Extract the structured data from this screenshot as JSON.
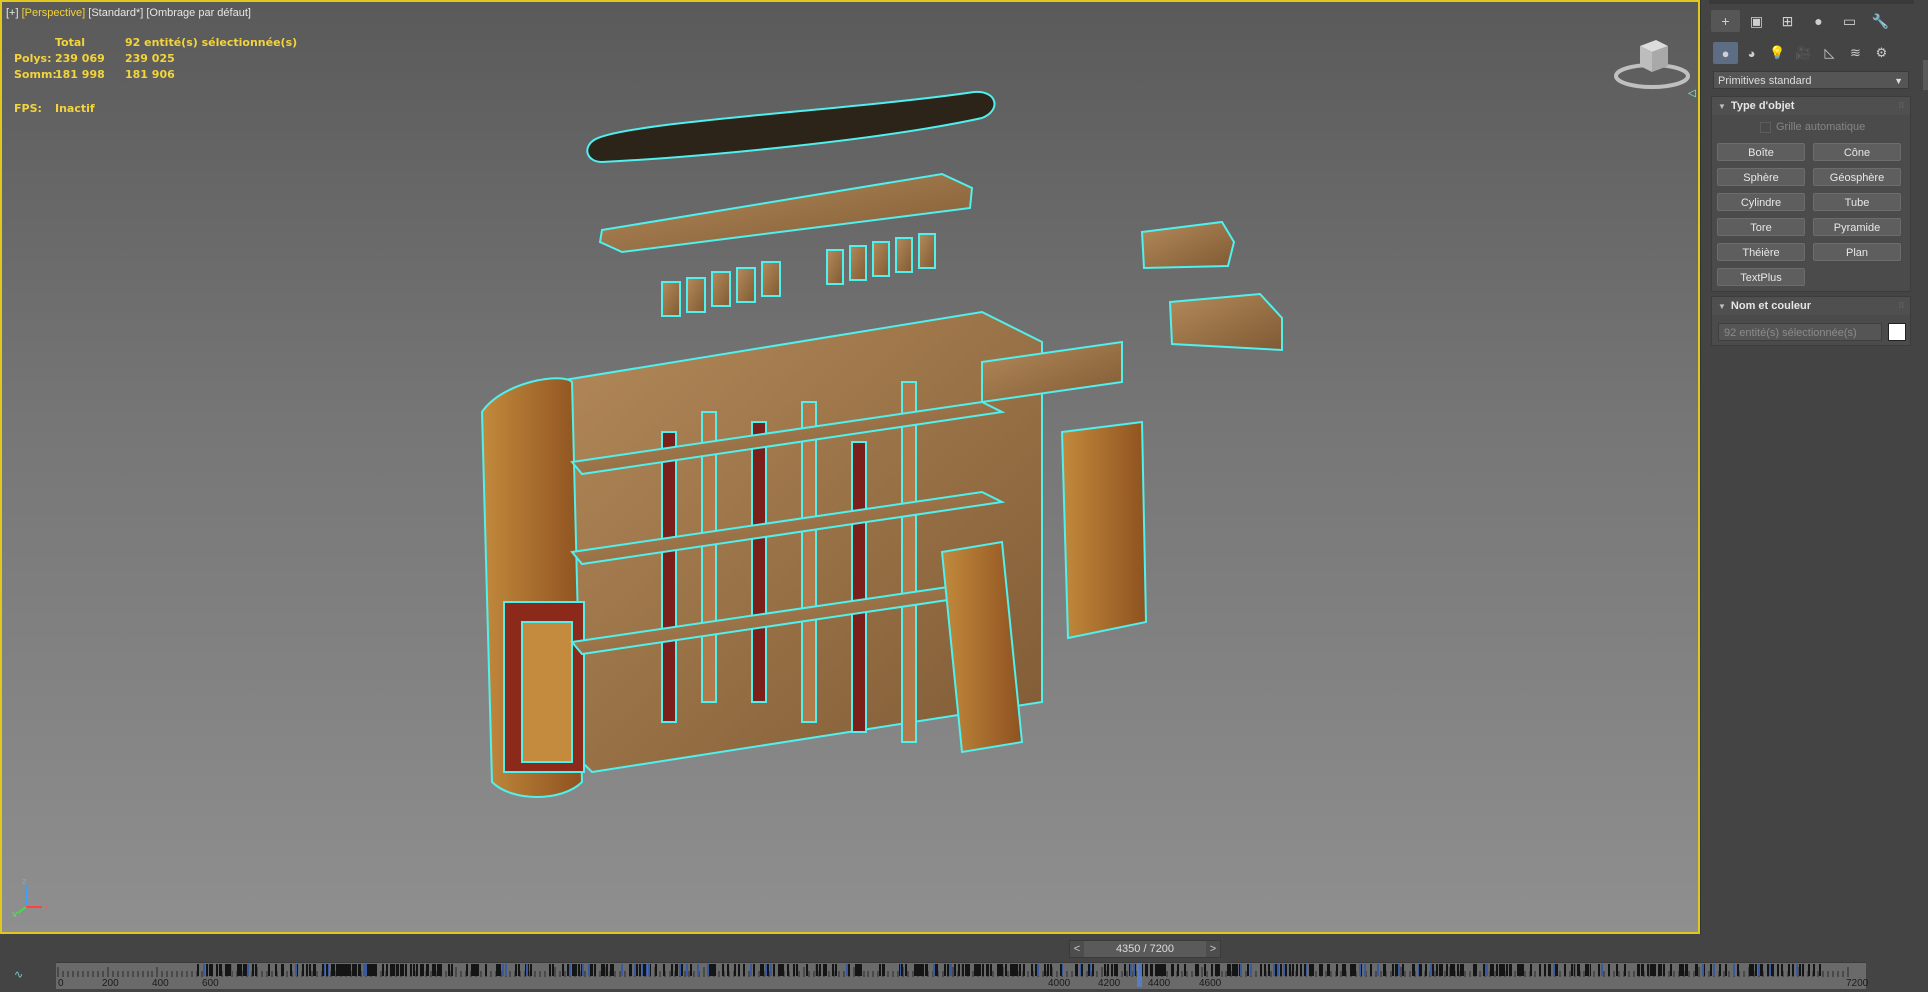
{
  "viewport": {
    "label_plus": "[+]",
    "label_view": "[Perspective]",
    "label_mode": "[Standard*]",
    "label_shading": "[Ombrage par défaut]",
    "stats": {
      "total_label": "Total",
      "selected_label": "92 entité(s) sélectionnée(s)",
      "polys_label": "Polys:",
      "polys_total": "239 069",
      "polys_selected": "239 025",
      "verts_label": "Somm:",
      "verts_total": "181 998",
      "verts_selected": "181 906",
      "fps_label": "FPS:",
      "fps_value": "Inactif"
    },
    "axis_labels": {
      "x": "x",
      "y": "y",
      "z": "z"
    },
    "selection_color": "#4ff0ee",
    "frame_color": "#e0c81e"
  },
  "command_panel": {
    "tabs": [
      "create-icon",
      "modify-icon",
      "hierarchy-icon",
      "motion-icon",
      "display-icon",
      "utilities-icon"
    ],
    "tab_glyphs": [
      "+",
      "▣",
      "⊞",
      "●",
      "▭",
      "🔧"
    ],
    "subtab_glyphs": [
      "●",
      "◕",
      "💡",
      "🎥",
      "◺",
      "≋",
      "⚙"
    ],
    "subtabs": [
      "geometry-icon",
      "shapes-icon",
      "lights-icon",
      "cameras-icon",
      "helpers-icon",
      "spacewarps-icon",
      "systems-icon"
    ],
    "category_dropdown": "Primitives standard",
    "object_type": {
      "title": "Type d'objet",
      "autogrid_label": "Grille automatique",
      "buttons": [
        "Boîte",
        "Cône",
        "Sphère",
        "Géosphère",
        "Cylindre",
        "Tube",
        "Tore",
        "Pyramide",
        "Théière",
        "Plan",
        "TextPlus"
      ]
    },
    "name_color": {
      "title": "Nom et couleur",
      "name_value": "92 entité(s) sélectionnée(s)",
      "swatch_color": "#ffffff"
    }
  },
  "time_slider": {
    "prev": "<",
    "label": "4350 / 7200",
    "next": ">",
    "current_frame": 4350,
    "total_frames": 7200
  },
  "trackbar": {
    "tick_labels": [
      "0",
      "200",
      "400",
      "600",
      "4000",
      "4200",
      "4400",
      "4600",
      "7200"
    ]
  }
}
